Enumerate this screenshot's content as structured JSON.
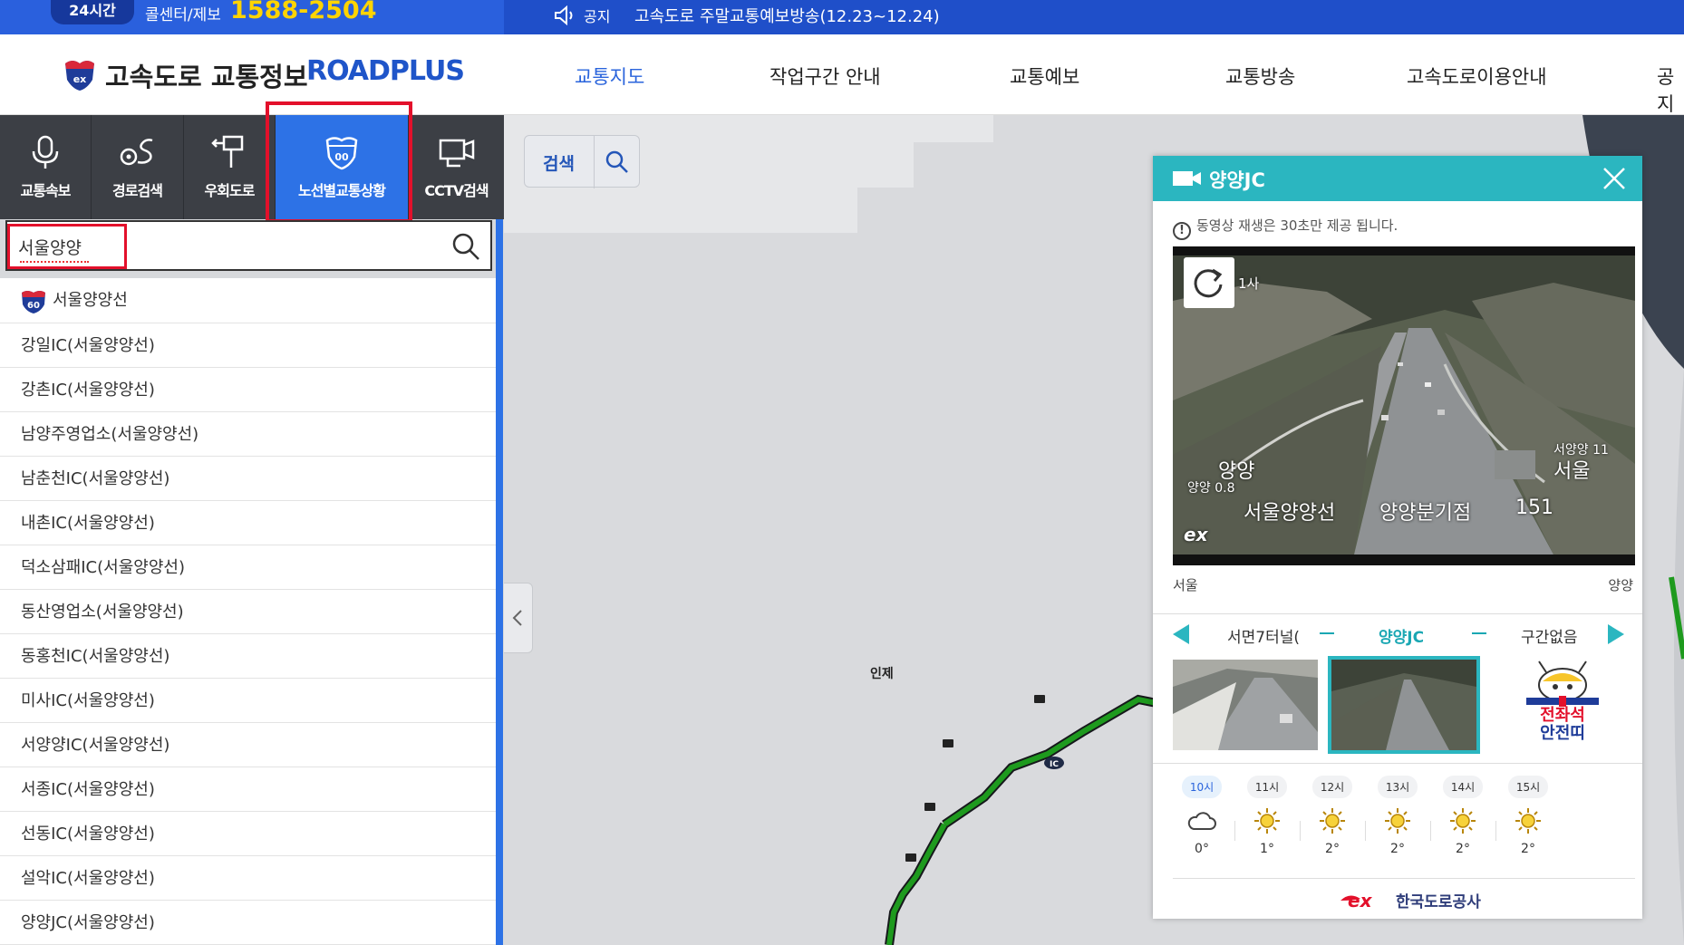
{
  "topbar": {
    "hours": "24시간",
    "callcenter_label": "콜센터/제보",
    "callcenter_number": "1588-2504",
    "notice_label": "공지",
    "notice_text": "고속도로 주말교통예보방송(12.23~12.24)"
  },
  "header": {
    "logo_text": "고속도로 교통정보",
    "logo_brand": "ROADPLUS",
    "nav": [
      "교통지도",
      "작업구간 안내",
      "교통예보",
      "교통방송",
      "고속도로이용안내",
      "공지"
    ],
    "nav_active": "교통지도"
  },
  "tabs": [
    {
      "label": "교통속보",
      "icon": "microphone-icon"
    },
    {
      "label": "경로검색",
      "icon": "route-pin-icon"
    },
    {
      "label": "우회도로",
      "icon": "detour-sign-icon"
    },
    {
      "label": "노선별교통상황",
      "icon": "route-shield-icon"
    },
    {
      "label": "CCTV검색",
      "icon": "cctv-camera-icon"
    }
  ],
  "search": {
    "value": "서울양양",
    "icon": "search-icon"
  },
  "results": {
    "route": {
      "number": "60",
      "name": "서울양양선"
    },
    "items": [
      "강일IC(서울양양선)",
      "강촌IC(서울양양선)",
      "남양주영업소(서울양양선)",
      "남춘천IC(서울양양선)",
      "내촌IC(서울양양선)",
      "덕소삼패IC(서울양양선)",
      "동산영업소(서울양양선)",
      "동홍천IC(서울양양선)",
      "미사IC(서울양양선)",
      "서양양IC(서울양양선)",
      "서종IC(서울양양선)",
      "선동IC(서울양양선)",
      "설악IC(서울양양선)",
      "양양JC(서울양양선)"
    ]
  },
  "map": {
    "search_label": "검색",
    "ic_badge": "IC",
    "place_label": "인제"
  },
  "popup": {
    "title": "양양JC",
    "notice": "동영상 재생은 30초만 제공 됩니다.",
    "video_overlay": {
      "top_text": "1사",
      "sign_left_main": "양양",
      "sign_left_sub": "양양 0.8",
      "sign_right_top": "서양양 11",
      "sign_right_main": "서울",
      "route_name": "서울양양선",
      "junction": "양양분기점",
      "km": "151",
      "watermark": "ex"
    },
    "direction_left": "서울",
    "direction_right": "양양",
    "ic_prev": "서면7터널(",
    "ic_current": "양양JC",
    "ic_next": "구간없음",
    "safety_line1": "전좌석",
    "safety_line2": "안전띠",
    "weather": [
      {
        "time": "10시",
        "icon": "cloud-icon",
        "temp": "0°"
      },
      {
        "time": "11시",
        "icon": "sun-icon",
        "temp": "1°"
      },
      {
        "time": "12시",
        "icon": "sun-icon",
        "temp": "2°"
      },
      {
        "time": "13시",
        "icon": "sun-icon",
        "temp": "2°"
      },
      {
        "time": "14시",
        "icon": "sun-icon",
        "temp": "2°"
      },
      {
        "time": "15시",
        "icon": "sun-icon",
        "temp": "2°"
      }
    ],
    "footer_brand": "한국도로공사"
  },
  "colors": {
    "topbar": "#1f4fc9",
    "tab_active": "#2d72e6",
    "popup_head": "#2bb6c0",
    "highlight_red": "#e3102b",
    "road_green": "#1e9a1e"
  }
}
